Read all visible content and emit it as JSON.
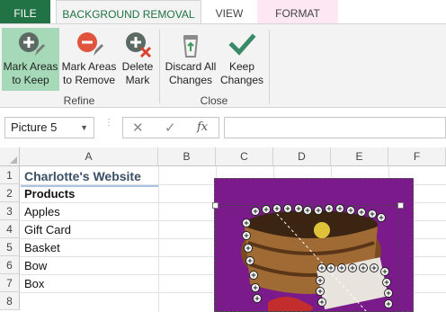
{
  "ribbon": {
    "tabs": [
      {
        "label": "FILE"
      },
      {
        "label": "BACKGROUND REMOVAL"
      },
      {
        "label": "VIEW"
      },
      {
        "label": "FORMAT"
      }
    ],
    "buttons": {
      "mark_keep": {
        "line1": "Mark Areas",
        "line2": "to Keep",
        "icon": "plus-circle-pencil-icon"
      },
      "mark_remove": {
        "line1": "Mark Areas",
        "line2": "to Remove",
        "icon": "minus-circle-pencil-icon"
      },
      "delete_mark": {
        "line1": "Delete",
        "line2": "Mark",
        "icon": "circle-x-icon"
      },
      "discard": {
        "line1": "Discard All",
        "line2": "Changes",
        "icon": "recycle-bin-icon"
      },
      "keep": {
        "line1": "Keep",
        "line2": "Changes",
        "icon": "checkmark-icon"
      }
    },
    "groups": {
      "refine": "Refine",
      "close": "Close"
    },
    "accent": "#217346"
  },
  "formula_bar": {
    "name_box": "Picture 5",
    "fx_label": "fx",
    "formula": ""
  },
  "sheet": {
    "columns": [
      "A",
      "B",
      "C",
      "D",
      "E",
      "F"
    ],
    "rows": [
      "1",
      "2",
      "3",
      "4",
      "5",
      "6",
      "7",
      "8"
    ],
    "cells": {
      "A1": "Charlotte's Website",
      "A2": "Products",
      "A3": "Apples",
      "A4": "Gift Card",
      "A5": "Basket",
      "A6": "Bow",
      "A7": "Box"
    }
  },
  "picture": {
    "name": "Picture 5",
    "background_color": "#7a1a8a"
  }
}
